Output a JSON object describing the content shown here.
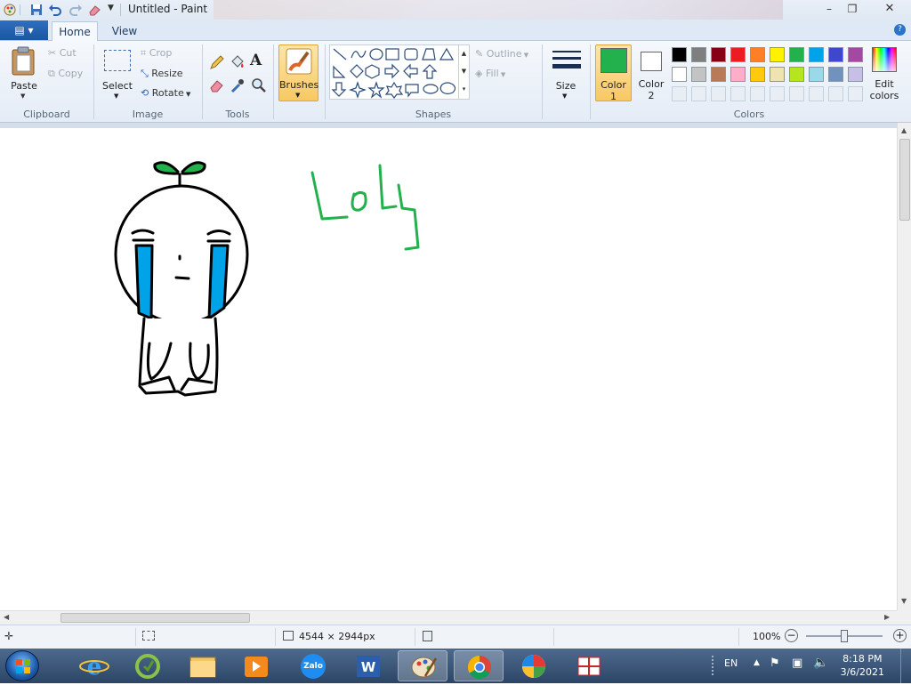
{
  "window": {
    "title": "Untitled - Paint"
  },
  "tabs": {
    "file_menu": "",
    "home": "Home",
    "view": "View"
  },
  "clipboard": {
    "paste": "Paste",
    "cut": "Cut",
    "copy": "Copy",
    "group": "Clipboard"
  },
  "image": {
    "select": "Select",
    "crop": "Crop",
    "resize": "Resize",
    "rotate": "Rotate",
    "group": "Image"
  },
  "tools": {
    "group": "Tools"
  },
  "brushes": {
    "label": "Brushes"
  },
  "shapes": {
    "outline": "Outline",
    "fill": "Fill",
    "group": "Shapes"
  },
  "size": {
    "label": "Size"
  },
  "colors": {
    "color1_label": "Color",
    "color1_num": "1",
    "color2_label": "Color",
    "color2_num": "2",
    "edit_colors_1": "Edit",
    "edit_colors_2": "colors",
    "group": "Colors",
    "color1": "#22b14c",
    "color2": "#ffffff",
    "palette_row1": [
      "#000000",
      "#7f7f7f",
      "#880015",
      "#ed1c24",
      "#ff7f27",
      "#fff200",
      "#22b14c",
      "#00a2e8",
      "#3f48cc",
      "#a349a4"
    ],
    "palette_row2": [
      "#ffffff",
      "#c3c3c3",
      "#b97a57",
      "#ffaec9",
      "#ffc90e",
      "#efe4b0",
      "#b5e61d",
      "#99d9ea",
      "#7092be",
      "#c8bfe7"
    ]
  },
  "status": {
    "dimensions": "4544 × 2944px",
    "zoom": "100%"
  },
  "taskbar": {
    "lang": "EN",
    "time": "8:18 PM",
    "date": "3/6/2021",
    "zalo": "Zalo"
  },
  "drawing": {
    "handwriting": "Loly"
  }
}
